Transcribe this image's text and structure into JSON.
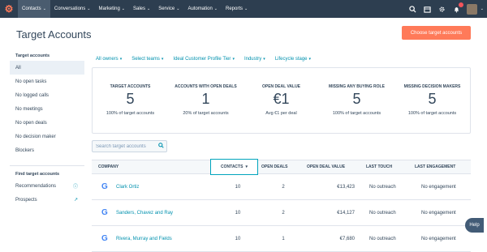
{
  "nav": {
    "items": [
      {
        "label": "Contacts",
        "active": true
      },
      {
        "label": "Conversations",
        "active": false
      },
      {
        "label": "Marketing",
        "active": false
      },
      {
        "label": "Sales",
        "active": false
      },
      {
        "label": "Service",
        "active": false
      },
      {
        "label": "Automation",
        "active": false
      },
      {
        "label": "Reports",
        "active": false
      }
    ],
    "notification_count": "3"
  },
  "page": {
    "title": "Target Accounts",
    "primary_button": "Choose target accounts"
  },
  "sidebar": {
    "heading": "Target accounts",
    "items": [
      "All",
      "No open tasks",
      "No logged calls",
      "No meetings",
      "No open deals",
      "No decision maker",
      "Blockers"
    ],
    "heading2": "Find target accounts",
    "items2": [
      "Recommendations",
      "Prospects"
    ]
  },
  "filters": [
    "All owners",
    "Select teams",
    "Ideal Customer Profile Tier",
    "Industry",
    "Lifecycle stage"
  ],
  "cards": [
    {
      "header": "TARGET ACCOUNTS",
      "value": "5",
      "sub": "100% of target accounts"
    },
    {
      "header": "ACCOUNTS WITH OPEN DEALS",
      "value": "1",
      "sub": "20% of target accounts"
    },
    {
      "header": "OPEN DEAL VALUE",
      "value": "€1",
      "sub": "Avg €1 per deal"
    },
    {
      "header": "MISSING ANY BUYING ROLE",
      "value": "5",
      "sub": "100% of target accounts"
    },
    {
      "header": "MISSING DECISION MAKERS",
      "value": "5",
      "sub": "100% of target accounts"
    }
  ],
  "search": {
    "placeholder": "Search target accounts"
  },
  "table": {
    "columns": [
      "COMPANY",
      "CONTACTS",
      "OPEN DEALS",
      "OPEN DEAL VALUE",
      "LAST TOUCH",
      "LAST ENGAGEMENT"
    ],
    "rows": [
      [
        "Clark Ortiz",
        "10",
        "2",
        "€13,423",
        "No outreach",
        "No engagement"
      ],
      [
        "Sanders, Chavez and Ray",
        "10",
        "2",
        "€14,127",
        "No outreach",
        "No engagement"
      ],
      [
        "Rivera, Murray and Fields",
        "10",
        "1",
        "€7,680",
        "No outreach",
        "No engagement"
      ]
    ]
  },
  "help_label": "Help",
  "colors": {
    "nav_bg": "#2d3e50",
    "accent": "#ff7a59",
    "link": "#0091ae"
  }
}
